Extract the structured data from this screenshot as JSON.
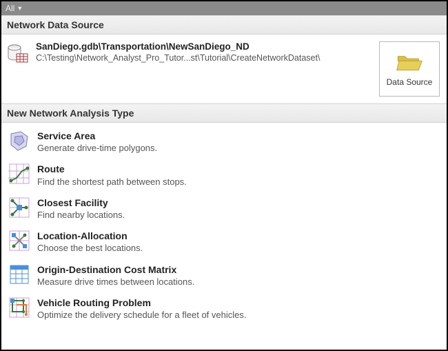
{
  "topbar": {
    "label": "All"
  },
  "sections": {
    "data_source_header": "Network Data Source",
    "analysis_header": "New Network Analysis Type"
  },
  "data_source": {
    "title": "SanDiego.gdb\\Transportation\\NewSanDiego_ND",
    "path": "C:\\Testing\\Network_Analyst_Pro_Tutor...st\\Tutorial\\CreateNetworkDataset\\",
    "button_label": "Data Source"
  },
  "analysis_types": [
    {
      "icon": "service-area-icon",
      "title": "Service Area",
      "desc": "Generate drive-time polygons."
    },
    {
      "icon": "route-icon",
      "title": "Route",
      "desc": "Find the shortest path between stops."
    },
    {
      "icon": "closest-facility-icon",
      "title": "Closest Facility",
      "desc": "Find nearby locations."
    },
    {
      "icon": "location-allocation-icon",
      "title": "Location-Allocation",
      "desc": "Choose the best locations."
    },
    {
      "icon": "od-cost-matrix-icon",
      "title": "Origin-Destination Cost Matrix",
      "desc": "Measure drive times between locations."
    },
    {
      "icon": "vrp-icon",
      "title": "Vehicle Routing Problem",
      "desc": "Optimize the delivery schedule for a fleet of vehicles."
    }
  ]
}
